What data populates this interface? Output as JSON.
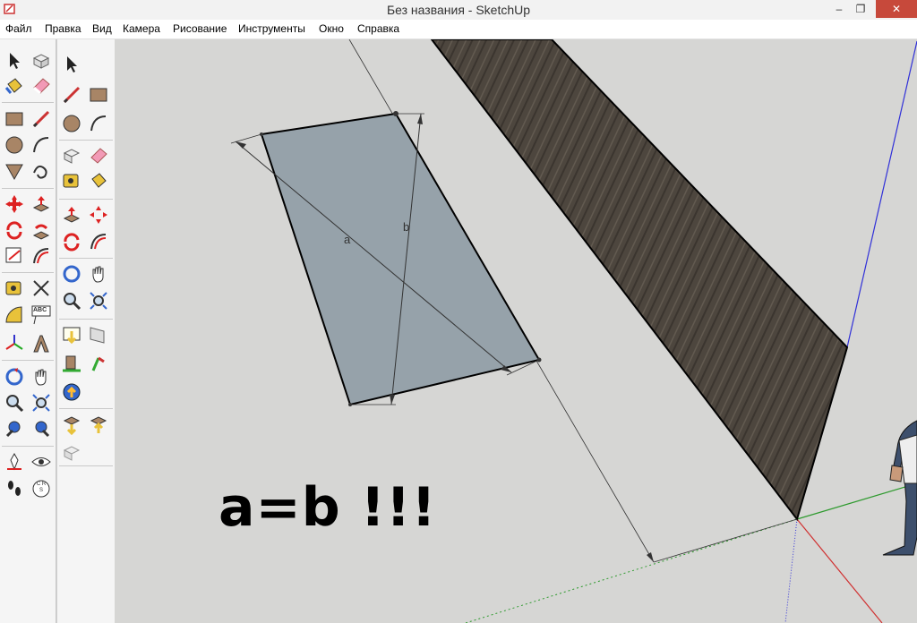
{
  "window": {
    "title": "Без названия - SketchUp",
    "minimize": "–",
    "maximize": "❐",
    "close": "✕"
  },
  "menu": [
    "Файл",
    "Правка",
    "Вид",
    "Камера",
    "Рисование",
    "Инструменты",
    "Окно",
    "Справка"
  ],
  "viewport": {
    "annotation": "a=b !!!",
    "dimension_a": "a",
    "dimension_b": "b"
  },
  "toolbar": {
    "text_tool_label": "ABC",
    "position_camera_label": "C R S"
  },
  "colors": {
    "background": "#d6d6d4",
    "face": "#96a2aa",
    "wall": "#4d463e",
    "axis_red": "#d03030",
    "axis_green": "#2e9a2e",
    "axis_blue": "#3030d8"
  }
}
